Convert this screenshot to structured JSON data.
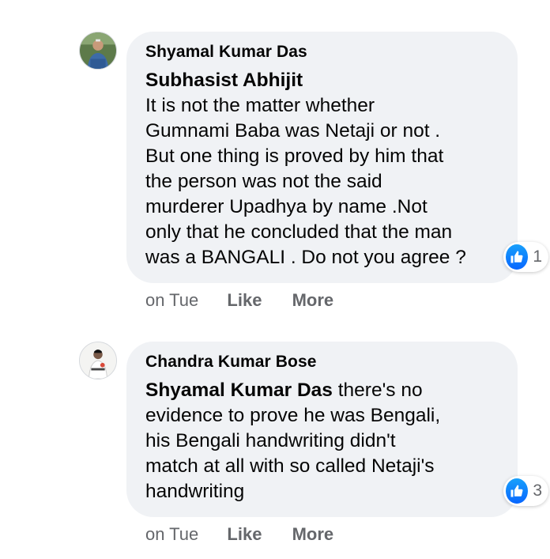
{
  "comments": [
    {
      "author": "Shyamal Kumar Das",
      "mention": "Subhasist Abhijit",
      "lines": [
        "It is not the matter whether",
        "Gumnami Baba was Netaji or not .",
        "But one thing is proved by him that",
        "the person was not the said",
        "murderer Upadhya by name .Not",
        "only that he concluded that the man",
        "was a BANGALI . Do not you agree ?"
      ],
      "reaction_count": "1",
      "time": "on Tue",
      "like_label": "Like",
      "more_label": "More"
    },
    {
      "author": "Chandra Kumar Bose",
      "mention": "Shyamal Kumar Das",
      "first_line_rest": " there's no",
      "lines": [
        "evidence to prove he was Bengali,",
        "his Bengali handwriting didn't",
        "match at all with so called Netaji's",
        "handwriting"
      ],
      "reaction_count": "3",
      "time": "on Tue",
      "like_label": "Like",
      "more_label": "More"
    }
  ],
  "colors": {
    "bubble": "#f0f2f5",
    "text": "#050505",
    "secondary": "#65676b",
    "like_blue": "#0866ff"
  },
  "icons": {
    "reaction": "thumbs-up-icon"
  }
}
